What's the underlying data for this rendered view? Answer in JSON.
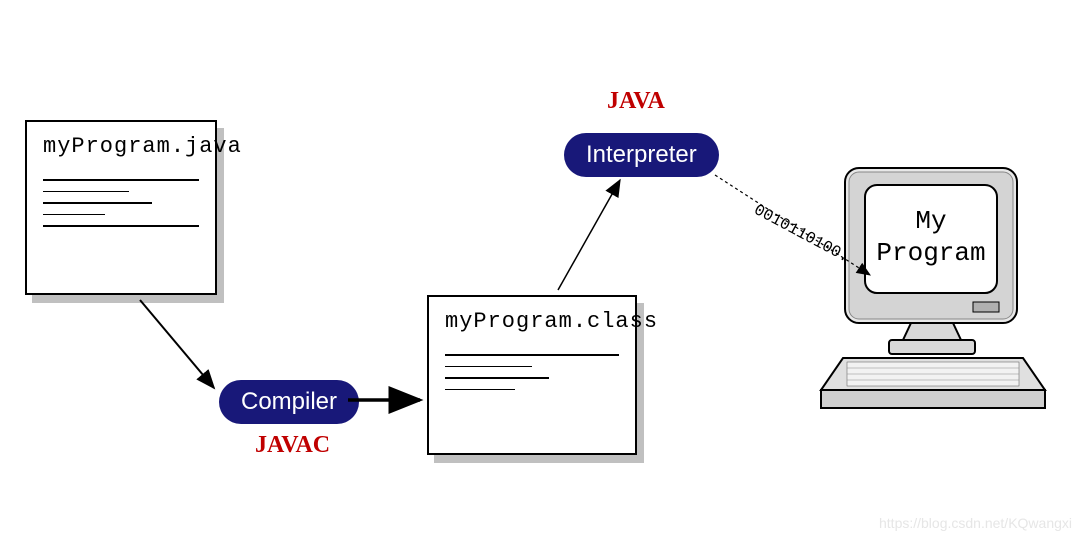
{
  "source_file": {
    "title": "myProgram.java"
  },
  "class_file": {
    "title": "myProgram.class"
  },
  "compiler": {
    "label": "Compiler",
    "red_label": "JAVAC"
  },
  "interpreter": {
    "label": "Interpreter",
    "red_label": "JAVA"
  },
  "binary_stream": "0010110100...",
  "output_program": {
    "line1": "My",
    "line2": "Program"
  },
  "watermark": "https://blog.csdn.net/KQwangxi"
}
